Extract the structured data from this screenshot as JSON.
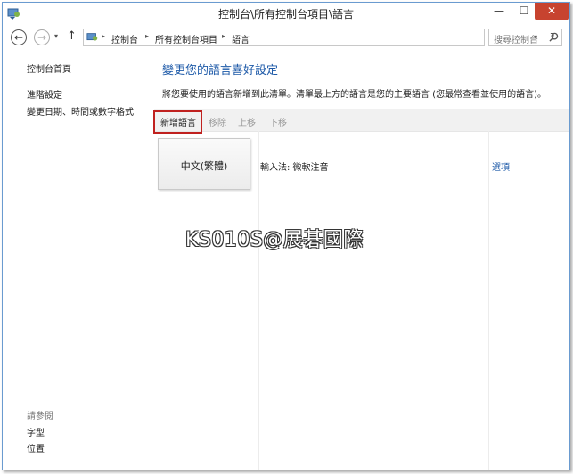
{
  "window": {
    "title": "控制台\\所有控制台項目\\語言",
    "minimize_label": "—",
    "maximize_label": "☐",
    "close_label": "✕"
  },
  "nav": {
    "back_glyph": "←",
    "forward_glyph": "→",
    "recent_glyph": "▾",
    "up_glyph": "↑"
  },
  "address": {
    "crumbs": [
      "控制台",
      "所有控制台項目",
      "語言"
    ],
    "separator_glyph": "▸",
    "dropdown_glyph": "▾",
    "refresh_glyph": "↻"
  },
  "search": {
    "placeholder": "搜尋控制台"
  },
  "sidebar": {
    "home": "控制台首頁",
    "advanced": "進階設定",
    "datetime": "變更日期、時間或數字格式",
    "see_also_header": "請參閱",
    "fonts": "字型",
    "location": "位置"
  },
  "main": {
    "title": "變更您的語言喜好設定",
    "description": "將您要使用的語言新增到此清單。清單最上方的語言是您的主要語言 (您最常查看並使用的語言)。"
  },
  "toolbar": {
    "add": "新增語言",
    "remove": "移除",
    "move_up": "上移",
    "move_down": "下移"
  },
  "languages": [
    {
      "name": "中文(繁體)",
      "ime": "輸入法: 微軟注音",
      "options": "選項"
    }
  ],
  "watermark": "KS010S@展碁國際",
  "colors": {
    "link": "#1e5aa8",
    "highlight": "#c0211f",
    "close_button": "#c7432f"
  }
}
